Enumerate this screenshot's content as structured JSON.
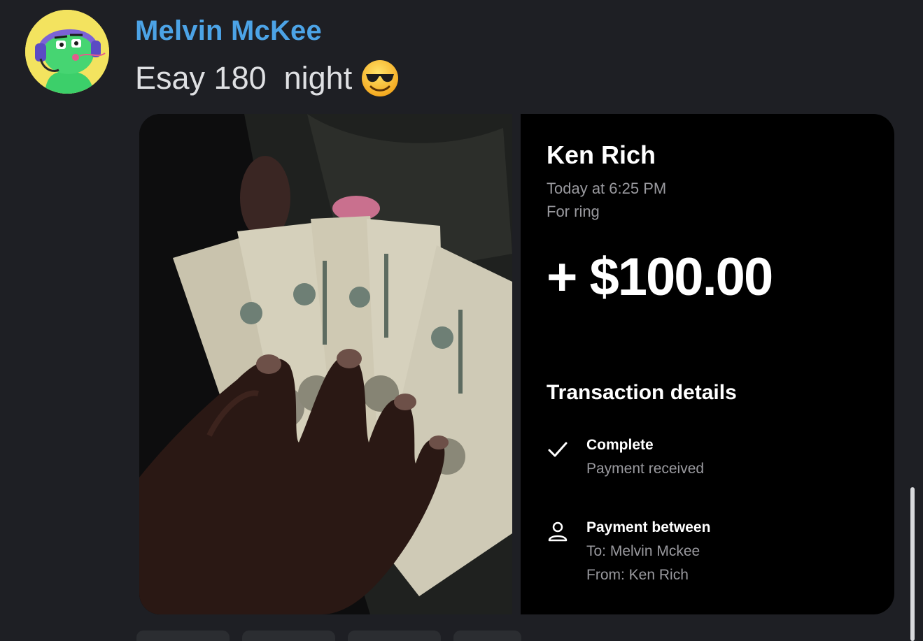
{
  "message": {
    "author": "Melvin McKee",
    "text": "Esay 180  night",
    "emoji": "smiling-face-with-sunglasses"
  },
  "attachment_photo": {
    "description_icon": "cash-photo"
  },
  "receipt": {
    "sender_name": "Ken Rich",
    "timestamp": "Today at 6:25 PM",
    "note": "For ring",
    "amount": "+ $100.00",
    "details_title": "Transaction details",
    "status_label": "Complete",
    "status_sub": "Payment received",
    "between_label": "Payment between",
    "to_line": "To: Melvin Mckee",
    "from_line": "From: Ken Rich"
  },
  "colors": {
    "background": "#1e1f24",
    "username": "#4ca3e6",
    "receipt_bg": "#000000",
    "muted_text": "#9a9a9f"
  }
}
